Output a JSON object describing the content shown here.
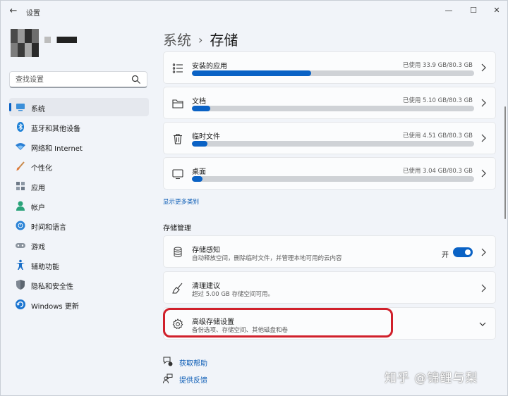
{
  "window": {
    "title": "设置",
    "back_glyph": "←",
    "min_glyph": "—",
    "max_glyph": "☐",
    "close_glyph": "✕"
  },
  "search": {
    "placeholder": "查找设置"
  },
  "sidebar": {
    "items": [
      {
        "label": "系统",
        "icon": "system-icon",
        "active": true
      },
      {
        "label": "蓝牙和其他设备",
        "icon": "bluetooth-icon"
      },
      {
        "label": "网络和 Internet",
        "icon": "wifi-icon"
      },
      {
        "label": "个性化",
        "icon": "brush-icon"
      },
      {
        "label": "应用",
        "icon": "apps-icon"
      },
      {
        "label": "帐户",
        "icon": "account-icon"
      },
      {
        "label": "时间和语言",
        "icon": "globe-clock-icon"
      },
      {
        "label": "游戏",
        "icon": "gamepad-icon"
      },
      {
        "label": "辅助功能",
        "icon": "accessibility-icon"
      },
      {
        "label": "隐私和安全性",
        "icon": "shield-icon"
      },
      {
        "label": "Windows 更新",
        "icon": "update-icon"
      }
    ]
  },
  "breadcrumb": {
    "parent": "系统",
    "separator": "›",
    "current": "存储"
  },
  "storage_items": [
    {
      "title": "安装的应用",
      "usage": "已使用 33.9 GB/80.3 GB",
      "used_fraction": 0.422,
      "icon": "list-icon"
    },
    {
      "title": "文档",
      "usage": "已使用 5.10 GB/80.3 GB",
      "used_fraction": 0.064,
      "icon": "folder-icon"
    },
    {
      "title": "临时文件",
      "usage": "已使用 4.51 GB/80.3 GB",
      "used_fraction": 0.056,
      "icon": "trash-icon"
    },
    {
      "title": "桌面",
      "usage": "已使用 3.04 GB/80.3 GB",
      "used_fraction": 0.038,
      "icon": "monitor-icon"
    }
  ],
  "show_more_link": "显示更多类别",
  "management": {
    "section_title": "存储管理",
    "storage_sense": {
      "title": "存储感知",
      "subtitle": "自动释放空间，删除临时文件，并管理本地可用的云内容",
      "toggle_label": "开",
      "toggle_on": true
    },
    "cleanup": {
      "title": "清理建议",
      "subtitle": "超过 5.00 GB 存储空间可用。"
    },
    "advanced": {
      "title": "高级存储设置",
      "subtitle": "备份选项、存储空间、其他磁盘和卷"
    }
  },
  "help": {
    "get_help": "获取帮助",
    "feedback": "提供反馈"
  },
  "watermark": "知乎 @锦鲤与梨",
  "colors": {
    "accent": "#0a62c5",
    "highlight": "#d0202b",
    "background": "#f1f4f9"
  }
}
